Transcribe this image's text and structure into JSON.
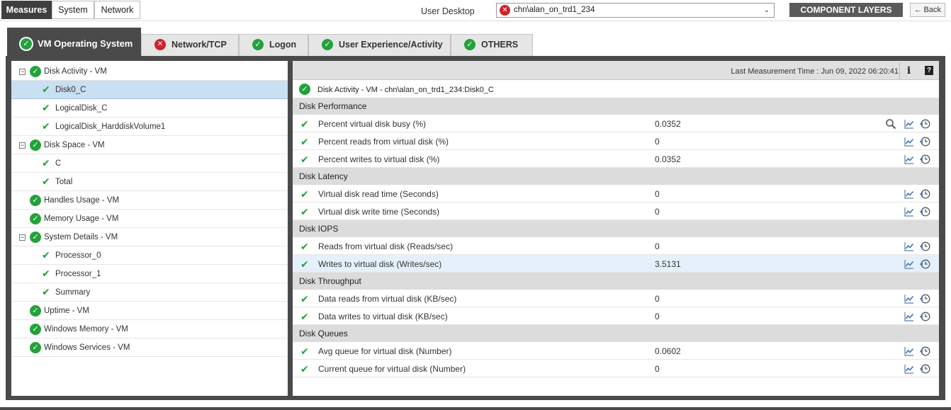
{
  "topbar": {
    "measures_label": "Measures",
    "system_label": "System",
    "network_label": "Network",
    "user_desktop_label": "User Desktop",
    "selected_component": "chn\\alan_on_trd1_234",
    "component_layers_label": "COMPONENT LAYERS",
    "back_label": "Back"
  },
  "tabs": [
    {
      "label": "VM Operating System",
      "status": "ok",
      "active": true
    },
    {
      "label": "Network/TCP",
      "status": "error",
      "active": false
    },
    {
      "label": "Logon",
      "status": "ok",
      "active": false
    },
    {
      "label": "User Experience/Activity",
      "status": "ok",
      "active": false
    },
    {
      "label": "OTHERS",
      "status": "ok",
      "active": false
    }
  ],
  "tree": [
    {
      "label": "Disk Activity - VM",
      "level": 0,
      "expand": "⊟"
    },
    {
      "label": "Disk0_C",
      "level": 1,
      "selected": true
    },
    {
      "label": "LogicalDisk_C",
      "level": 1
    },
    {
      "label": "LogicalDisk_HarddiskVolume1",
      "level": 1
    },
    {
      "label": "Disk Space - VM",
      "level": 0,
      "expand": "⊟"
    },
    {
      "label": "C",
      "level": 1
    },
    {
      "label": "Total",
      "level": 1
    },
    {
      "label": "Handles Usage - VM",
      "level": 0
    },
    {
      "label": "Memory Usage - VM",
      "level": 0
    },
    {
      "label": "System Details - VM",
      "level": 0,
      "expand": "⊟"
    },
    {
      "label": "Processor_0",
      "level": 1
    },
    {
      "label": "Processor_1",
      "level": 1
    },
    {
      "label": "Summary",
      "level": 1
    },
    {
      "label": "Uptime - VM",
      "level": 0
    },
    {
      "label": "Windows Memory - VM",
      "level": 0
    },
    {
      "label": "Windows Services - VM",
      "level": 0
    }
  ],
  "panel": {
    "last_measurement": "Last Measurement Time : Jun 09, 2022 06:20:41",
    "info_icon": "i",
    "help_icon": "?",
    "title": "Disk Activity - VM - chn\\alan_on_trd1_234:Disk0_C",
    "groups": [
      {
        "name": "Disk Performance",
        "rows": [
          {
            "name": "Percent virtual disk busy (%)",
            "value": "0.0352",
            "search": true
          },
          {
            "name": "Percent reads from virtual disk (%)",
            "value": "0"
          },
          {
            "name": "Percent writes to virtual disk (%)",
            "value": "0.0352"
          }
        ]
      },
      {
        "name": "Disk Latency",
        "rows": [
          {
            "name": "Virtual disk read time (Seconds)",
            "value": "0"
          },
          {
            "name": "Virtual disk write time (Seconds)",
            "value": "0"
          }
        ]
      },
      {
        "name": "Disk IOPS",
        "rows": [
          {
            "name": "Reads from virtual disk (Reads/sec)",
            "value": "0"
          },
          {
            "name": "Writes to virtual disk (Writes/sec)",
            "value": "3.5131",
            "highlight": true
          }
        ]
      },
      {
        "name": "Disk Throughput",
        "rows": [
          {
            "name": "Data reads from virtual disk (KB/sec)",
            "value": "0"
          },
          {
            "name": "Data writes to virtual disk (KB/sec)",
            "value": "0"
          }
        ]
      },
      {
        "name": "Disk Queues",
        "rows": [
          {
            "name": "Avg queue for virtual disk (Number)",
            "value": "0.0602"
          },
          {
            "name": "Current queue for virtual disk (Number)",
            "value": "0"
          }
        ]
      }
    ]
  },
  "icons": {
    "ok": "✓",
    "error": "✕",
    "check": "✔",
    "back_arrow": "←",
    "dropdown": "⌄"
  },
  "colors": {
    "ok": "#23a13a",
    "error": "#d0222b",
    "dark_frame": "#4a4a4a",
    "selected_row": "#c9dff2"
  }
}
